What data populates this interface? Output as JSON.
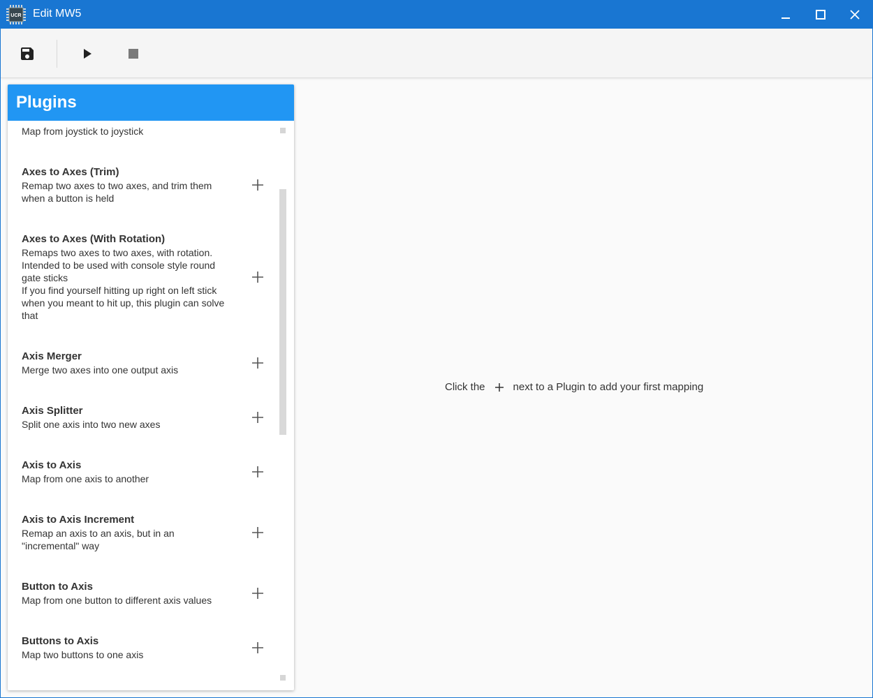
{
  "window": {
    "title": "Edit MW5",
    "app_icon_text": "UCR",
    "accent_color": "#1976d2"
  },
  "toolbar": {
    "save_icon": "save-icon",
    "play_icon": "play-icon",
    "stop_icon": "stop-icon"
  },
  "plugins": {
    "title": "Plugins",
    "header_color": "#2196f3",
    "partial_item_desc": "Map from joystick to joystick",
    "items": [
      {
        "title": "Axes to Axes (Trim)",
        "desc": "Remap two axes to two axes, and trim them\nwhen a button is held"
      },
      {
        "title": "Axes to Axes (With Rotation)",
        "desc": "Remaps two axes to two axes, with rotation.\nIntended to be used with console style round\ngate sticks\nIf you find yourself hitting up right on left stick\nwhen you meant to hit up, this plugin can solve\nthat"
      },
      {
        "title": "Axis Merger",
        "desc": "Merge two axes into one output axis"
      },
      {
        "title": "Axis Splitter",
        "desc": "Split one axis into two new axes"
      },
      {
        "title": "Axis to Axis",
        "desc": "Map from one axis to another"
      },
      {
        "title": "Axis to Axis Increment",
        "desc": "Remap an axis to an axis, but in an\n\"incremental\" way"
      },
      {
        "title": "Button to Axis",
        "desc": "Map from one button to different axis values"
      },
      {
        "title": "Buttons to Axis",
        "desc": "Map two buttons to one axis"
      }
    ]
  },
  "main": {
    "empty_before": "Click the",
    "empty_after": "next to a Plugin to add your first mapping"
  }
}
